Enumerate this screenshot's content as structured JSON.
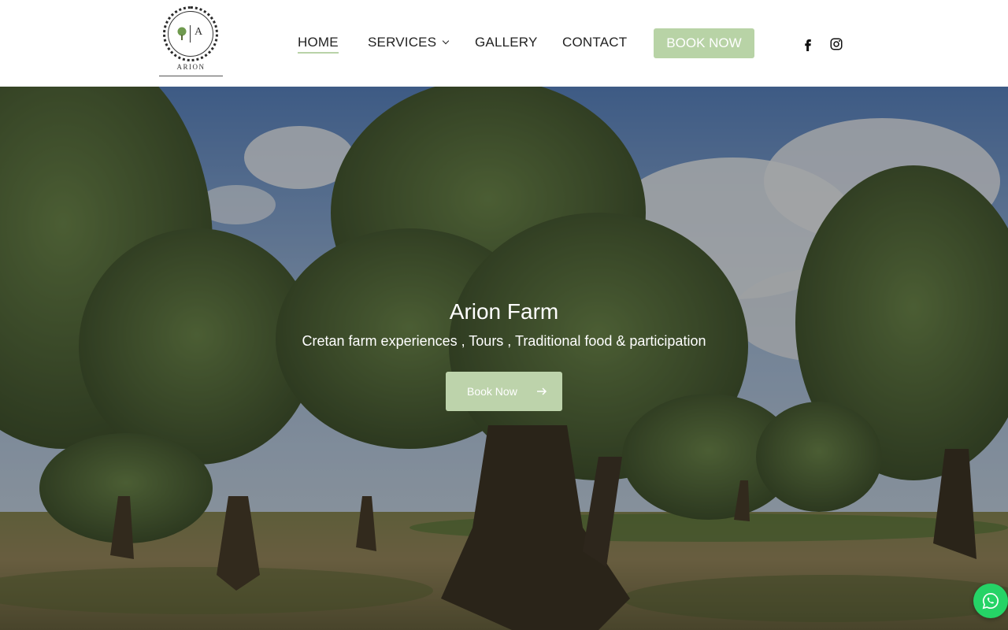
{
  "brand": {
    "logo_letter": "A",
    "logo_name": "ARION"
  },
  "nav": {
    "home": "HOME",
    "services": "SERVICES",
    "gallery": "GALLERY",
    "contact": "CONTACT",
    "book_now": "BOOK NOW"
  },
  "social": {
    "facebook_icon": "facebook-icon",
    "instagram_icon": "instagram-icon"
  },
  "hero": {
    "title": "Arion Farm",
    "subtitle": "Cretan farm experiences , Tours , Traditional food & participation",
    "cta_label": "Book Now"
  },
  "floating": {
    "whatsapp_icon": "whatsapp-icon"
  },
  "colors": {
    "accent": "#b8d3a6",
    "whatsapp": "#25d366"
  }
}
